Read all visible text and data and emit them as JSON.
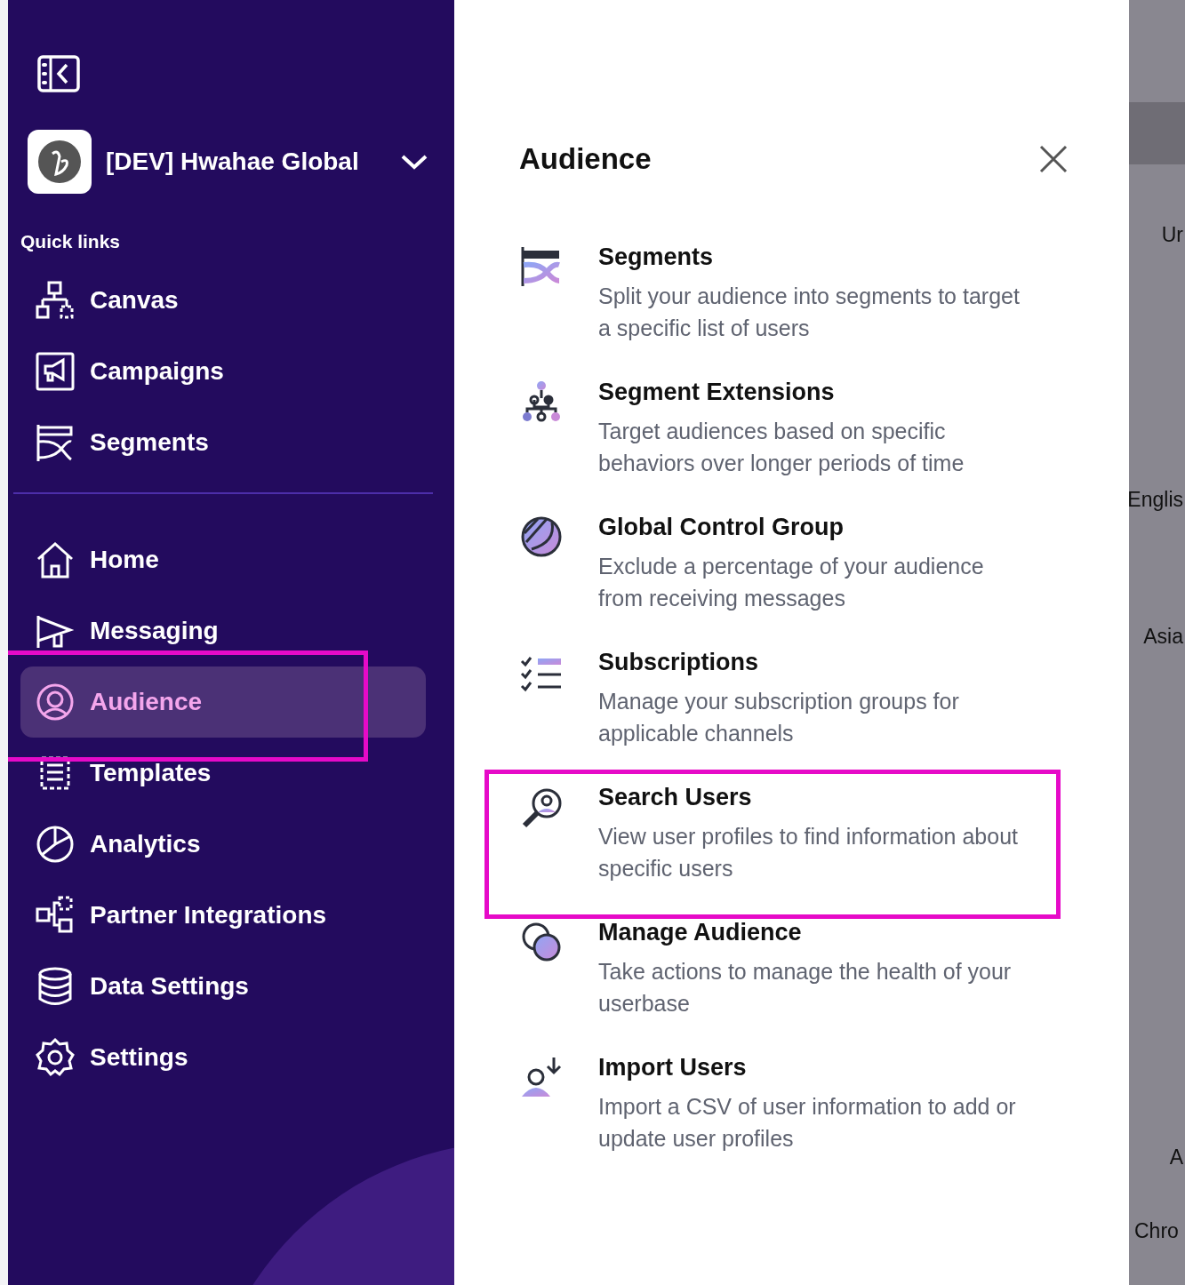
{
  "sidebar": {
    "workspace": {
      "name": "[DEV] Hwahae Global"
    },
    "quick_links_heading": "Quick links",
    "quick_links": [
      {
        "label": "Canvas",
        "kind": "canvas"
      },
      {
        "label": "Campaigns",
        "kind": "campaigns"
      },
      {
        "label": "Segments",
        "kind": "segments"
      }
    ],
    "nav": [
      {
        "label": "Home",
        "kind": "home",
        "selected": false,
        "highlighted": false
      },
      {
        "label": "Messaging",
        "kind": "messaging",
        "selected": false,
        "highlighted": false
      },
      {
        "label": "Audience",
        "kind": "audience",
        "selected": true,
        "highlighted": true
      },
      {
        "label": "Templates",
        "kind": "templates",
        "selected": false,
        "highlighted": false
      },
      {
        "label": "Analytics",
        "kind": "analytics",
        "selected": false,
        "highlighted": false
      },
      {
        "label": "Partner Integrations",
        "kind": "partner",
        "selected": false,
        "highlighted": false
      },
      {
        "label": "Data Settings",
        "kind": "data",
        "selected": false,
        "highlighted": false
      },
      {
        "label": "Settings",
        "kind": "settings",
        "selected": false,
        "highlighted": false
      }
    ]
  },
  "panel": {
    "title": "Audience",
    "items": [
      {
        "title": "Segments",
        "description": "Split your audience into segments to target a specific list of users",
        "kind": "segments",
        "highlighted": false
      },
      {
        "title": "Segment Extensions",
        "description": "Target audiences based on specific behaviors over longer periods of time",
        "kind": "extensions",
        "highlighted": false
      },
      {
        "title": "Global Control Group",
        "description": "Exclude a percentage of your audience from receiving messages",
        "kind": "control",
        "highlighted": false
      },
      {
        "title": "Subscriptions",
        "description": "Manage your subscription groups for applicable channels",
        "kind": "subscriptions",
        "highlighted": false
      },
      {
        "title": "Search Users",
        "description": "View user profiles to find information about specific users",
        "kind": "search",
        "highlighted": true
      },
      {
        "title": "Manage Audience",
        "description": "Take actions to manage the health of your userbase",
        "kind": "manage",
        "highlighted": false
      },
      {
        "title": "Import Users",
        "description": "Import a CSV of user information to add or update user profiles",
        "kind": "import",
        "highlighted": false
      }
    ]
  },
  "background_page": {
    "texts": [
      "Ur",
      "Englis",
      "Asia",
      "A",
      "Chro"
    ]
  }
}
